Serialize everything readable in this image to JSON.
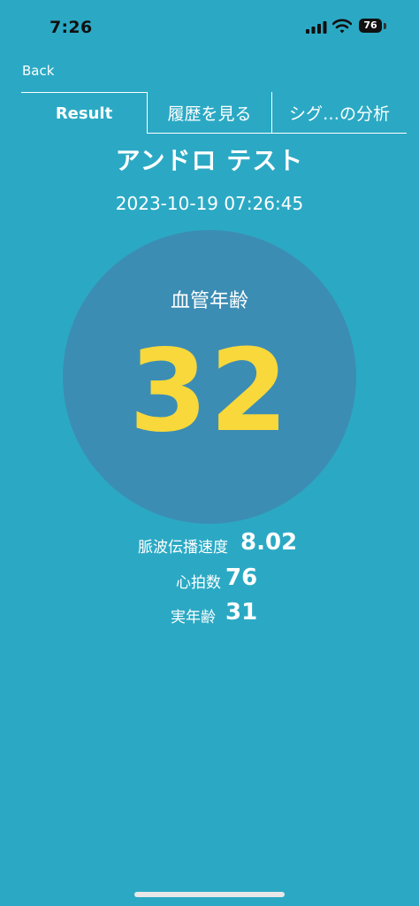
{
  "status_bar": {
    "time": "7:26",
    "battery": "76",
    "icons": [
      "signal-icon",
      "wifi-icon",
      "battery-icon"
    ]
  },
  "nav": {
    "back_label": "Back"
  },
  "tabs": [
    {
      "label": "Result",
      "selected": true
    },
    {
      "label": "履歴を見る",
      "selected": false
    },
    {
      "label": "シグ…の分析",
      "selected": false
    }
  ],
  "test": {
    "title": "アンドロ テスト",
    "timestamp": "2023-10-19 07:26:45"
  },
  "result": {
    "label": "血管年齢",
    "value": "32"
  },
  "metrics": [
    {
      "label": "脈波伝播速度",
      "value": "8.02"
    },
    {
      "label": "心拍数",
      "value": "76"
    },
    {
      "label": "実年齢",
      "value": "31"
    }
  ],
  "colors": {
    "background": "#2BA9C4",
    "circle": "#3C8DB4",
    "accent": "#F8D83A"
  }
}
